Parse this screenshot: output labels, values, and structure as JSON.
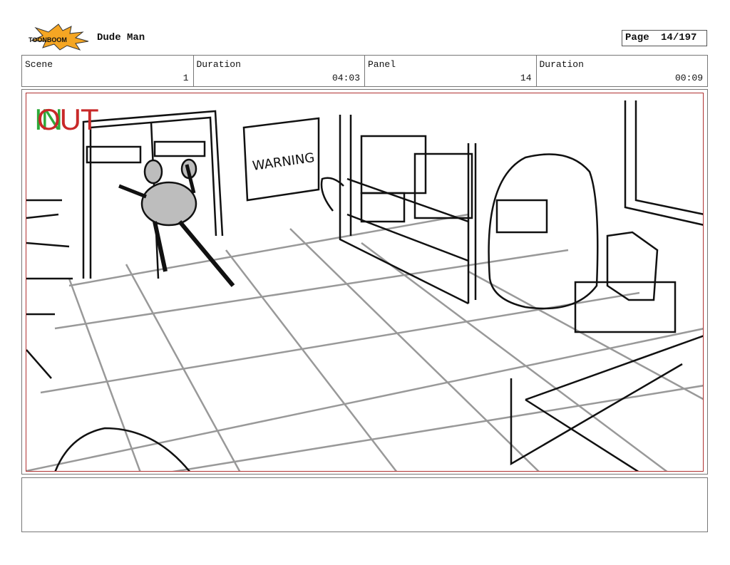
{
  "header": {
    "logo_text": "TOONBOOM",
    "project_title": "Dude Man",
    "page_label": "Page",
    "page_number": "14/197"
  },
  "info": {
    "scene_label": "Scene",
    "scene_value": "1",
    "duration_label": "Duration",
    "duration_value": "04:03",
    "panel_label": "Panel",
    "panel_value": "14",
    "panel_duration_label": "Duration",
    "panel_duration_value": "00:09"
  },
  "panel": {
    "in_marker": "IN",
    "out_marker": "OUT",
    "sign_text": "WARNING"
  },
  "notes": {
    "text": ""
  }
}
